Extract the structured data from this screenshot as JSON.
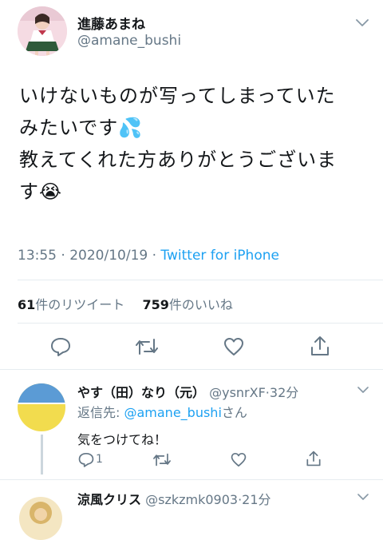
{
  "tweet": {
    "display_name": "進藤あまね",
    "handle": "@amane_bushi",
    "text_lines": [
      "いけないものが写ってしまっていた",
      "みたいです💦",
      "教えてくれた方ありがとうございま",
      "す😭"
    ],
    "time": "13:55",
    "date": "2020/10/19",
    "client": "Twitter for iPhone",
    "retweet_count": "61",
    "retweet_label": "件のリツイート",
    "like_count": "759",
    "like_label": "件のいいね"
  },
  "reply1": {
    "display_name": "やす（田）なり（元）",
    "handle": "@ysnrXF",
    "time": "32分",
    "reply_to_prefix": "返信先: ",
    "reply_to_handle": "@amane_bushi",
    "reply_to_suffix": "さん",
    "text": "気をつけてね！",
    "reply_count": "1"
  },
  "reply2": {
    "display_name": "涼風クリス",
    "handle": "@szkzmk0903",
    "time": "21分"
  },
  "icons": [
    "chevron-down-icon",
    "reply-icon",
    "retweet-icon",
    "like-icon",
    "share-icon"
  ],
  "colors": {
    "accent": "#1da1f2",
    "muted": "#657786",
    "divider": "#e6ecf0"
  }
}
